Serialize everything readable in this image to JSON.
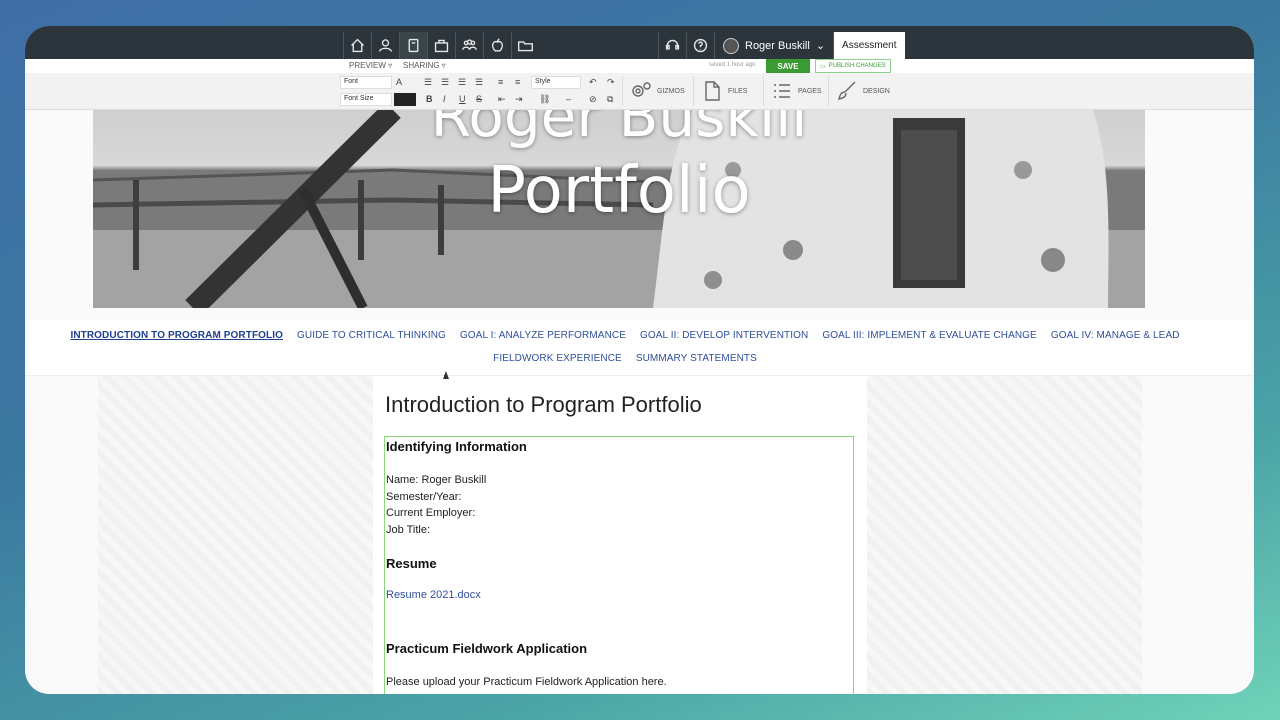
{
  "top_nav": {
    "icons": [
      "home-icon",
      "user-icon",
      "portfolio-icon",
      "briefcase-icon",
      "group-icon",
      "apple-icon",
      "folder-icon"
    ],
    "active": "portfolio-icon",
    "right_icons": [
      "support-icon",
      "help-icon"
    ],
    "user_name": "Roger Buskill",
    "assessment_label": "Assessment"
  },
  "subbar": {
    "preview": "PREVIEW",
    "sharing": "SHARING",
    "saved": "saved 1 hour ago",
    "save": "SAVE",
    "publish": "PUBLISH CHANGES"
  },
  "toolbar": {
    "font": "Font",
    "font_size": "Font Size",
    "style": "Style",
    "gizmos": "GIZMOS",
    "files": "FILES",
    "pages": "PAGES",
    "design": "DESIGN",
    "bold": "B",
    "italic": "I",
    "underline": "U",
    "strike": "S",
    "font_color": "A"
  },
  "banner": {
    "line1": "Roger Buskill",
    "line2": "Portfolio"
  },
  "nav_links": [
    "INTRODUCTION TO PROGRAM PORTFOLIO",
    "GUIDE TO CRITICAL THINKING",
    "GOAL I: ANALYZE PERFORMANCE",
    "GOAL II: DEVELOP INTERVENTION",
    "GOAL III: IMPLEMENT & EVALUATE CHANGE",
    "GOAL IV: MANAGE & LEAD",
    "FIELDWORK EXPERIENCE",
    "SUMMARY STATEMENTS"
  ],
  "page": {
    "title": "Introduction to Program Portfolio",
    "identifying_heading": "Identifying Information",
    "name": "Name: Roger Buskill",
    "semester": "Semester/Year:",
    "employer": "Current Employer:",
    "job_title": "Job Title:",
    "resume_heading": "Resume",
    "resume_link": "Resume 2021.docx",
    "practicum_heading": "Practicum Fieldwork Application",
    "practicum_text": "Please upload your Practicum Fieldwork Application here."
  }
}
